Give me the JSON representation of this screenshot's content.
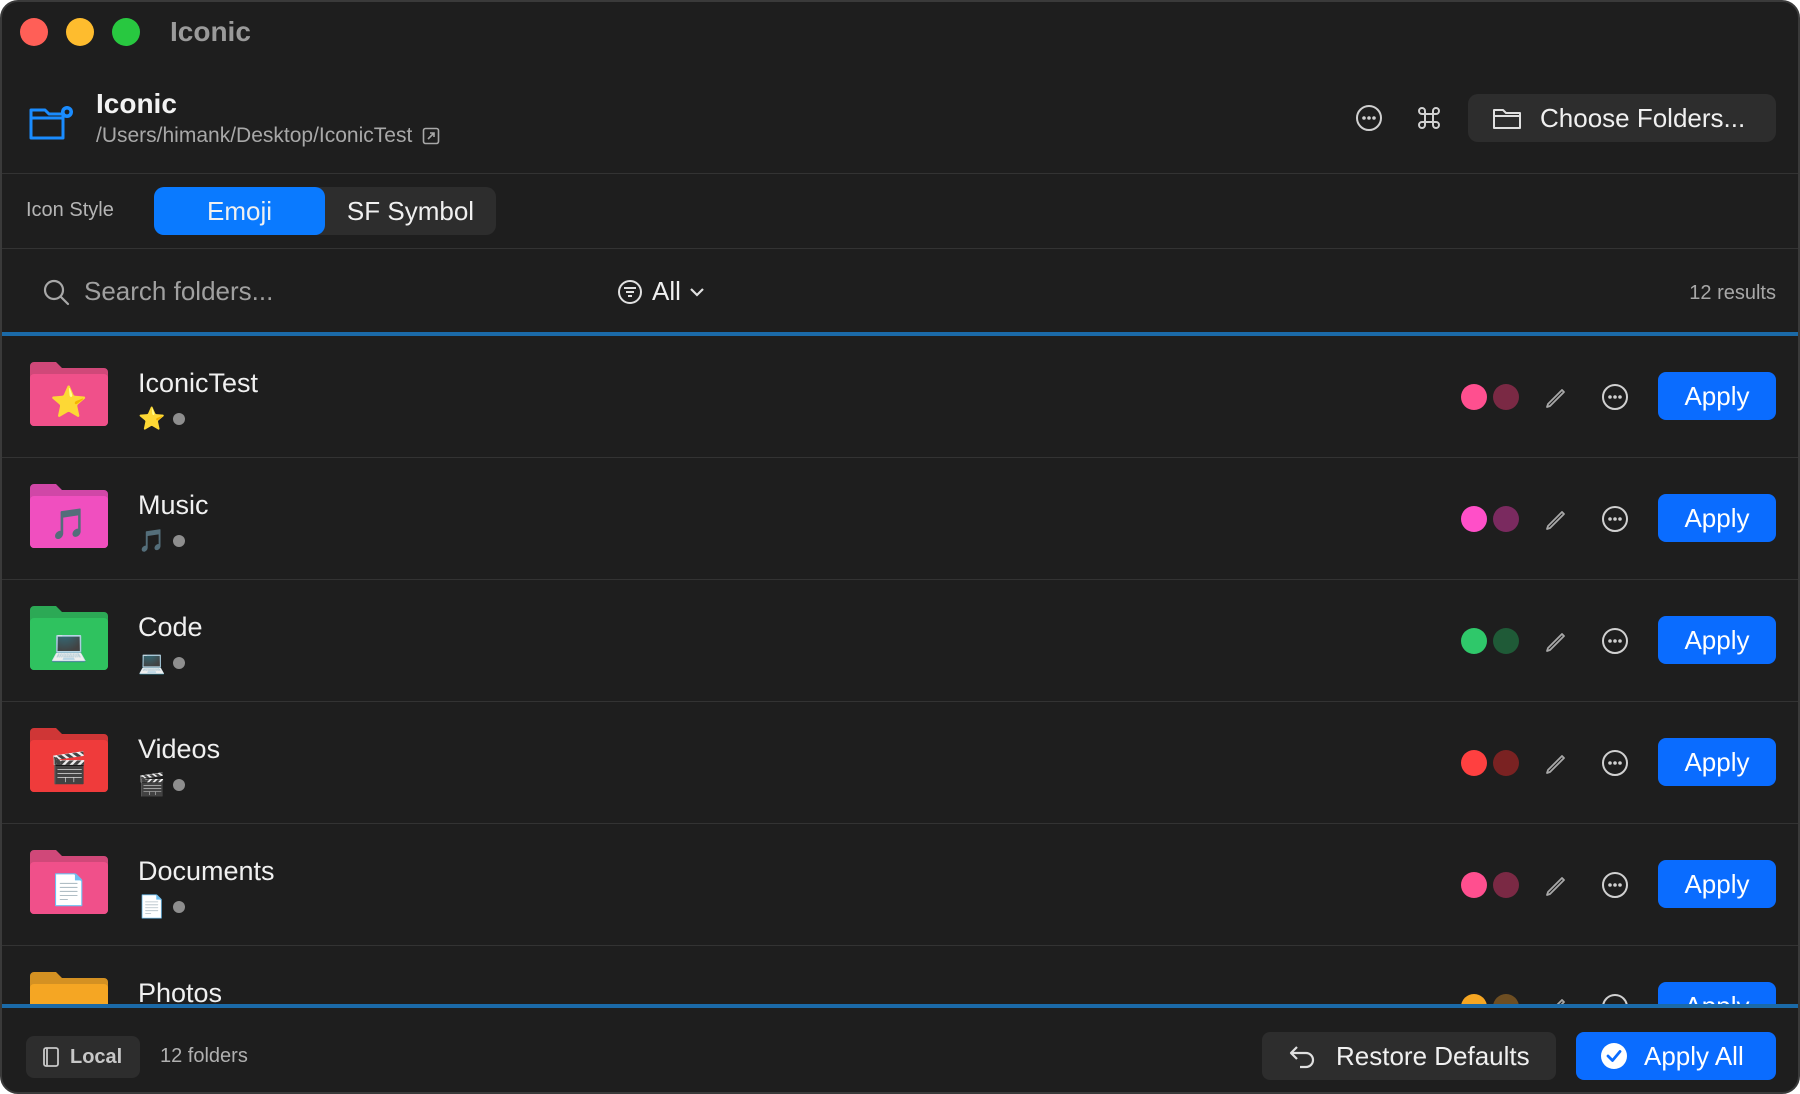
{
  "window": {
    "title": "Iconic"
  },
  "header": {
    "app_name": "Iconic",
    "path": "/Users/himank/Desktop/IconicTest",
    "choose_folders_label": "Choose Folders..."
  },
  "icon_style": {
    "label": "Icon Style",
    "options": [
      "Emoji",
      "SF Symbol"
    ],
    "selected": "Emoji"
  },
  "search": {
    "placeholder": "Search folders...",
    "filter_label": "All",
    "results_text": "12 results"
  },
  "folders": [
    {
      "name": "IconicTest",
      "emoji": "⭐",
      "folder_color": "#f0508a",
      "swatch_primary": "#ff4f8f",
      "swatch_secondary": "#7a2944",
      "apply_label": "Apply"
    },
    {
      "name": "Music",
      "emoji": "🎵",
      "folder_color": "#f04fbf",
      "swatch_primary": "#ff4fc8",
      "swatch_secondary": "#7a2a5f",
      "apply_label": "Apply"
    },
    {
      "name": "Code",
      "emoji": "💻",
      "folder_color": "#2fc25f",
      "swatch_primary": "#2fc86a",
      "swatch_secondary": "#1f5a37",
      "apply_label": "Apply"
    },
    {
      "name": "Videos",
      "emoji": "🎬",
      "folder_color": "#ef3b3b",
      "swatch_primary": "#ff4040",
      "swatch_secondary": "#7a2222",
      "apply_label": "Apply"
    },
    {
      "name": "Documents",
      "emoji": "📄",
      "folder_color": "#f0508a",
      "swatch_primary": "#ff4f8f",
      "swatch_secondary": "#7a2944",
      "apply_label": "Apply"
    },
    {
      "name": "Photos",
      "emoji": "",
      "folder_color": "#f5a623",
      "swatch_primary": "#f5a623",
      "swatch_secondary": "#6e4e22",
      "apply_label": "Apply"
    }
  ],
  "footer": {
    "storage_label": "Local",
    "folders_count": "12 folders",
    "restore_label": "Restore Defaults",
    "apply_all_label": "Apply All"
  },
  "colors": {
    "accent": "#0a6cff",
    "background": "#1e1e1e",
    "divider": "#1b6aa8"
  }
}
